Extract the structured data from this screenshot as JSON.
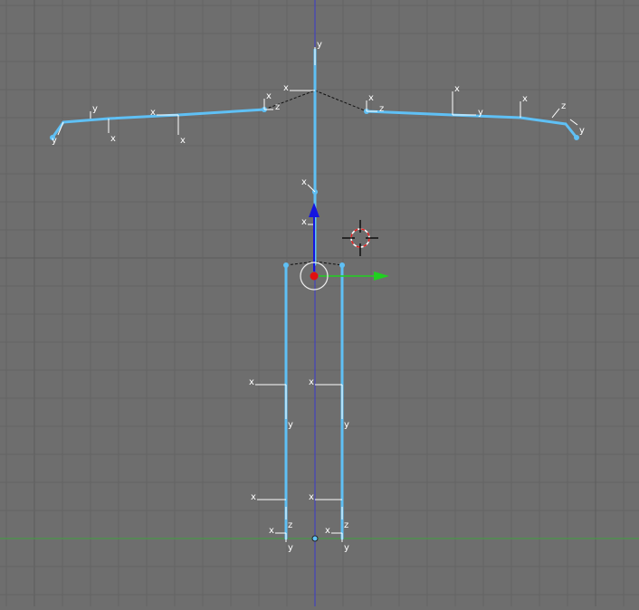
{
  "viewport": {
    "background_color": "#6e6e6e",
    "grid_minor_color": "#646464",
    "grid_major_color": "#5c5c5c",
    "x_axis_color": "#3fa33f",
    "z_axis_color": "#3a3acc",
    "bone_color": "#5fc0f5",
    "axis_label_color": "#ffffff"
  },
  "axis_labels": {
    "x": "x",
    "y": "y",
    "z": "z"
  },
  "gizmo": {
    "z_arrow_color": "#1515e0",
    "y_arrow_color": "#20d020",
    "origin_color": "#e01010",
    "cursor_icon": "3d-cursor-icon"
  }
}
